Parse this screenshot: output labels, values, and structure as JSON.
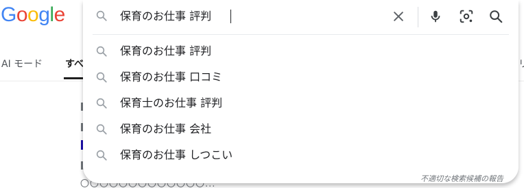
{
  "logo": {
    "letters": [
      "G",
      "o",
      "o",
      "g",
      "l",
      "e"
    ],
    "colors": [
      "#4285f4",
      "#ea4335",
      "#fbbc05",
      "#4285f4",
      "#34a853",
      "#ea4335"
    ]
  },
  "search": {
    "query": "保育のお仕事 評判",
    "suggestions": [
      "保育のお仕事 評判",
      "保育のお仕事 口コミ",
      "保育士のお仕事 評判",
      "保育のお仕事 会社",
      "保育のお仕事 しつこい"
    ],
    "report_label": "不適切な検索候補の報告"
  },
  "tabs": {
    "ai_mode": "AI モード",
    "all": "すべ",
    "right_partial": "リ"
  },
  "background": {
    "snippet_tail": "〇〇〇〇〇〇〇〇〇〇〇〇〇..."
  },
  "colors": {
    "text": "#202124",
    "icon": "#5f6368",
    "muted": "#70757a"
  }
}
